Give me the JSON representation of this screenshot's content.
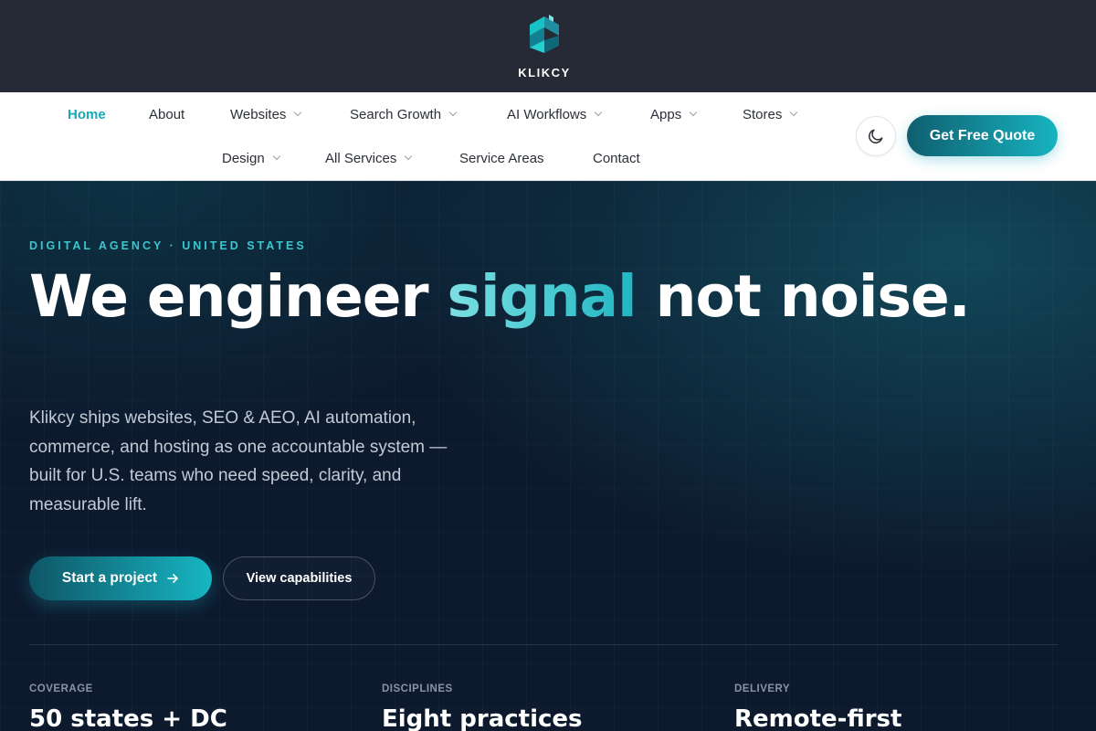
{
  "brand": {
    "name": "KLIKCY",
    "colors": {
      "accent": "#17a9b8",
      "topbar": "#262a36",
      "hero_bg": "#0d1a2e"
    }
  },
  "nav": {
    "items": [
      {
        "label": "Home",
        "active": true,
        "dropdown": false
      },
      {
        "label": "About",
        "active": false,
        "dropdown": false
      },
      {
        "label": "Websites",
        "active": false,
        "dropdown": true
      },
      {
        "label": "Search Growth",
        "active": false,
        "dropdown": true
      },
      {
        "label": "AI Workflows",
        "active": false,
        "dropdown": true
      },
      {
        "label": "Apps",
        "active": false,
        "dropdown": true
      },
      {
        "label": "Stores",
        "active": false,
        "dropdown": true
      },
      {
        "label": "Design",
        "active": false,
        "dropdown": true
      },
      {
        "label": "All Services",
        "active": false,
        "dropdown": true
      },
      {
        "label": "Service Areas",
        "active": false,
        "dropdown": false
      },
      {
        "label": "Contact",
        "active": false,
        "dropdown": false
      }
    ],
    "theme_toggle_icon": "moon-icon",
    "cta_label": "Get Free Quote"
  },
  "hero": {
    "eyebrow": "DIGITAL AGENCY · UNITED STATES",
    "headline_before": "We engineer ",
    "headline_accent": "signal",
    "headline_after": " not noise.",
    "lede": "Klikcy ships websites, SEO & AEO, AI automation, commerce, and hosting as one accountable system — built for U.S. teams who need speed, clarity, and measurable lift.",
    "primary_cta": "Start a project",
    "primary_cta_icon": "arrow-right-icon",
    "secondary_cta": "View capabilities"
  },
  "stats": [
    {
      "label": "COVERAGE",
      "value": "50 states + DC"
    },
    {
      "label": "DISCIPLINES",
      "value": "Eight practices"
    },
    {
      "label": "DELIVERY",
      "value": "Remote-first"
    }
  ]
}
